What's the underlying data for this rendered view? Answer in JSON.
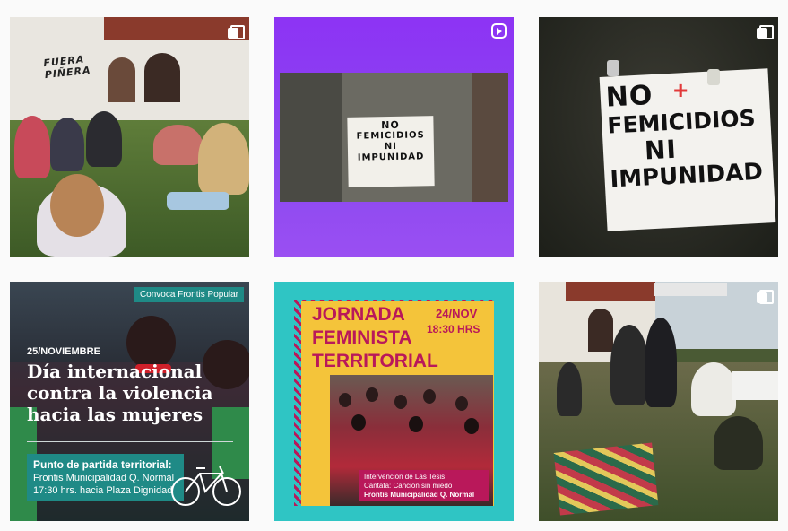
{
  "posts": [
    {
      "graffiti": "FUERA PIÑERA"
    },
    {
      "sign": {
        "line1": "NO",
        "line2": "FEMICIDIOS",
        "line3": "NI",
        "line4": "IMPUNIDAD"
      },
      "icon": "igtv-icon"
    },
    {
      "sign": {
        "line1": "NO",
        "line2": "FEMICIDIOS",
        "line3": "NI",
        "line4": "IMPUNIDAD"
      },
      "icon": "multi-photo-icon"
    },
    {
      "badge": "Convoca Frontis Popular",
      "date": "25/NOVIEMBRE",
      "title": "Día internacional contra la violencia hacia las mujeres",
      "footer_line1": "Punto de partida territorial:",
      "footer_line2": "Frontis Municipalidad Q. Normal",
      "footer_line3": "17:30 hrs. hacia Plaza Dignidad"
    },
    {
      "title_line1": "JORNADA",
      "title_line2": "FEMINISTA",
      "title_line3": "TERRITORIAL",
      "date": "24/NOV",
      "time": "18:30 HRS",
      "caption_line1": "Intervención de Las Tesis",
      "caption_line2": "Cantata: Canción sin miedo",
      "caption_line3": "Frontis Municipalidad Q. Normal"
    },
    {
      "banner": "",
      "icon": "multi-photo-icon"
    }
  ],
  "colors": {
    "purple": "#8a3bf2",
    "teal": "#2fc5c4",
    "yellow": "#f4c43a",
    "magenta": "#b9185a",
    "dark_teal": "#1e7f80"
  }
}
